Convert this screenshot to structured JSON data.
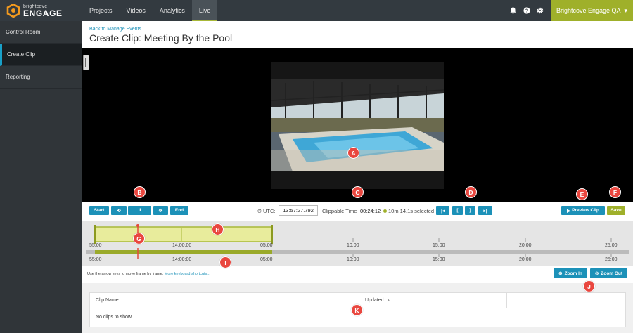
{
  "brand": {
    "small": "brightcove",
    "large": "ENGAGE"
  },
  "nav": {
    "items": [
      {
        "label": "Projects"
      },
      {
        "label": "Videos"
      },
      {
        "label": "Analytics"
      },
      {
        "label": "Live"
      }
    ],
    "active": "Live"
  },
  "account": {
    "label": "Brightcove Engage QA",
    "caret": "▾"
  },
  "icons": {
    "bell": "bell-icon",
    "help": "help-icon",
    "settings": "gear-icon"
  },
  "sidebar": {
    "items": [
      {
        "label": "Control Room"
      },
      {
        "label": "Create Clip"
      },
      {
        "label": "Reporting"
      }
    ],
    "active": "Create Clip"
  },
  "header": {
    "back": "Back to Manage Events",
    "title": "Create Clip: Meeting By the Pool"
  },
  "controls": {
    "start": "Start",
    "back": "⟲",
    "pause": "II",
    "forward": "⟳",
    "end": "End",
    "utc_label": "UTC:",
    "utc_value": "13:57:27.792",
    "clippable_label": "Clippable Time",
    "clippable_value": "00:24:12",
    "selected": "10m 14.1s selected",
    "nav_first": "|◂",
    "nav_in": "[",
    "nav_out": "]",
    "nav_last": "▸|",
    "preview": "Preview Clip",
    "save": "Save"
  },
  "timeline": {
    "upper_ticks": [
      "55:00",
      "14:00:00",
      "05:00",
      "10:00",
      "15:00",
      "20:00",
      "25:00"
    ],
    "lower_ticks": [
      "55:00",
      "14:00:00",
      "05:00",
      "10:00",
      "15:00",
      "20:00",
      "25:00"
    ]
  },
  "hint": {
    "text": "Use the arrow keys to move frame by frame.",
    "link": "More keyboard shortcuts..."
  },
  "zoom": {
    "in": "Zoom In",
    "out": "Zoom Out"
  },
  "table": {
    "columns": [
      "Clip Name",
      "Updated"
    ],
    "sort_indicator": "▲",
    "empty": "No clips to show"
  },
  "callouts": [
    "A",
    "B",
    "C",
    "D",
    "E",
    "F",
    "G",
    "H",
    "I",
    "J",
    "K"
  ],
  "colors": {
    "accent": "#1c91b8",
    "brand": "#9fb02a",
    "callout": "#e9473f",
    "nav_bg": "#333a40"
  }
}
